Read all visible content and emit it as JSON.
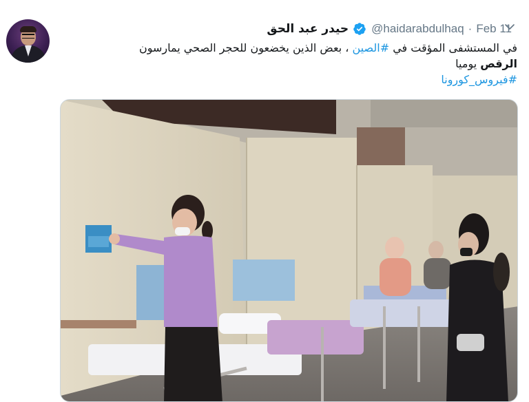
{
  "tweet": {
    "author_name": "حيدر عبد الحق",
    "handle": "@haidarabdulhaq",
    "separator": "·",
    "date": "Feb 11",
    "text_line1_prefix": "في المستشفى المؤقت في ",
    "hashtag_china": "#الصين",
    "text_line1_suffix": " ، بعض الذين يخضعون للحجر الصحي يمارسون",
    "text_line2_bold": "الرقص",
    "text_line2_rest": " يوميا",
    "hashtag_corona": "#فيروس_كورونا"
  },
  "colors": {
    "link": "#1b95e0",
    "secondary_text": "#657786",
    "verified_badge": "#1da1f2"
  },
  "icons": {
    "verified": "verified-badge-icon",
    "menu": "chevron-down-icon"
  }
}
